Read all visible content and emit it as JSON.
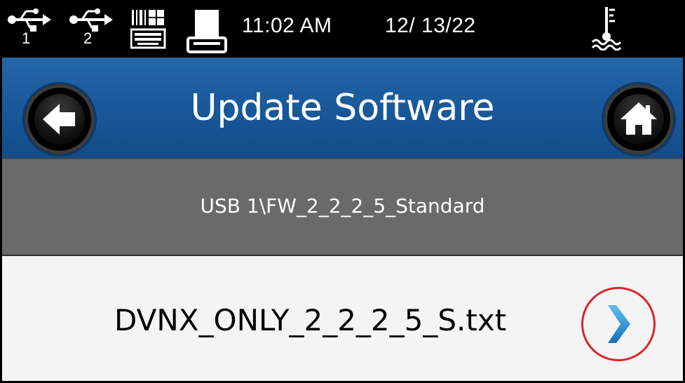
{
  "status_bar": {
    "usb1": {
      "icon": "usb-icon",
      "number": "1"
    },
    "usb2": {
      "icon": "usb-icon",
      "number": "2"
    },
    "keyboard_icon": "keyboard-icon",
    "printer_icon": "printer-icon",
    "time": "11:02 AM",
    "date": "12/ 13/22",
    "temp_icon": "temperature-icon"
  },
  "header": {
    "title": "Update Software",
    "back_icon": "back-arrow-icon",
    "home_icon": "home-icon",
    "color": "#1a5a9c"
  },
  "path_bar": {
    "path": "USB  1\\FW_2_2_2_5_Standard"
  },
  "files": [
    {
      "name": "DVNX_ONLY_2_2_2_5_S.txt",
      "action_icon": "chevron-right-icon"
    }
  ],
  "colors": {
    "highlight_ring": "#d9262a",
    "chevron": "#2a8fd6"
  }
}
